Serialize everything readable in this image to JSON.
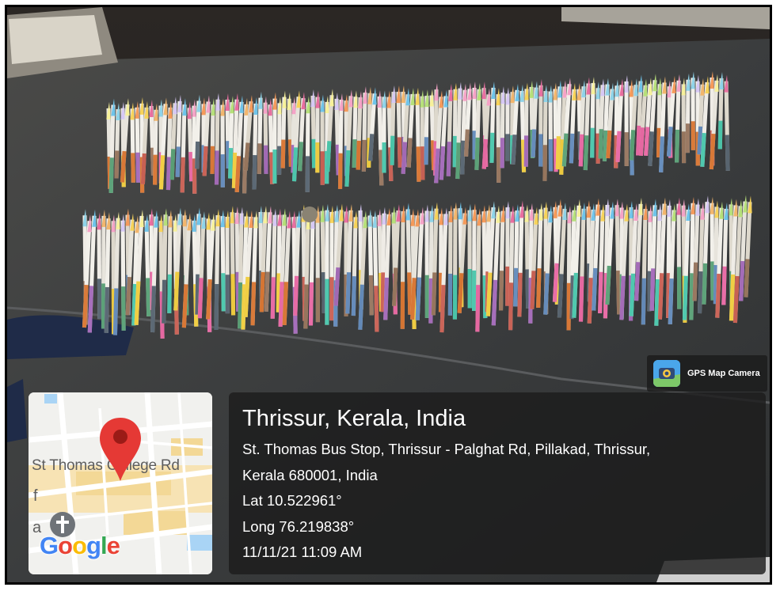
{
  "photo": {
    "description_icon": "pencil-stack-photo",
    "colors": {
      "table": "#3a3c3d",
      "background": "#2a2826",
      "pencil_body": "#e7e4dc"
    }
  },
  "badge": {
    "icon": "gps-map-camera-icon",
    "label": "GPS Map Camera"
  },
  "map": {
    "road_label": "St Thomas College Rd",
    "edge_letter_1": "f",
    "edge_letter_2": "a",
    "pin_icon": "map-pin-icon",
    "church_icon": "church-cross-icon",
    "logo": {
      "letters": [
        "G",
        "o",
        "o",
        "g",
        "l",
        "e"
      ],
      "colors": [
        "#4285f4",
        "#ea4335",
        "#fbbc05",
        "#4285f4",
        "#34a853",
        "#ea4335"
      ]
    },
    "pin_color": "#e53935"
  },
  "info": {
    "title": "Thrissur, Kerala, India",
    "address_line_1": "St. Thomas Bus Stop, Thrissur - Palghat Rd, Pillakad, Thrissur,",
    "address_line_2": "Kerala 680001, India",
    "latitude": "Lat 10.522961°",
    "longitude": "Long 76.219838°",
    "timestamp": "11/11/21 11:09 AM"
  }
}
